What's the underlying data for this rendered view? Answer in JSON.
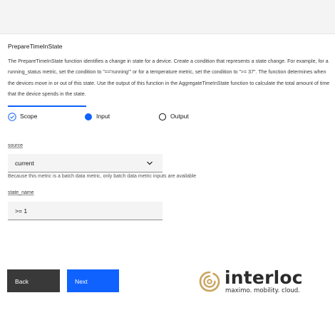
{
  "panel": {
    "title": "PrepareTimeInState",
    "description": "The PrepareTimeInState function identifies a change in state for a device. Create a condition that represents a state change. For example, for a running_status metric, set the condition to \"=='running'\" or for a temperature metric, set the condition to \">= 37\". The function determines when the devices move in or out of this state. Use the output of this function in the AggregateTimeInState function to calculate the total amount of time that the device spends in the state."
  },
  "progress": {
    "steps": [
      {
        "label": "Scope",
        "state": "complete",
        "icon": "check-circle-icon"
      },
      {
        "label": "Input",
        "state": "current",
        "icon": "current-step-icon"
      },
      {
        "label": "Output",
        "state": "incomplete",
        "icon": "empty-circle-icon"
      }
    ]
  },
  "form": {
    "source": {
      "label": "source",
      "value": "current",
      "helper": "Because this metric is a batch data metric, only batch data metric inputs are available"
    },
    "state_name": {
      "label": "state_name",
      "value": ">= 1"
    }
  },
  "buttons": {
    "back": "Back",
    "next": "Next"
  },
  "logo": {
    "name": "interloc",
    "tagline": "maximo. mobility. cloud."
  },
  "colors": {
    "primary": "#0f62fe",
    "secondary": "#393939",
    "field_bg": "#f4f4f4",
    "logo_gold": "#c9a35c"
  }
}
